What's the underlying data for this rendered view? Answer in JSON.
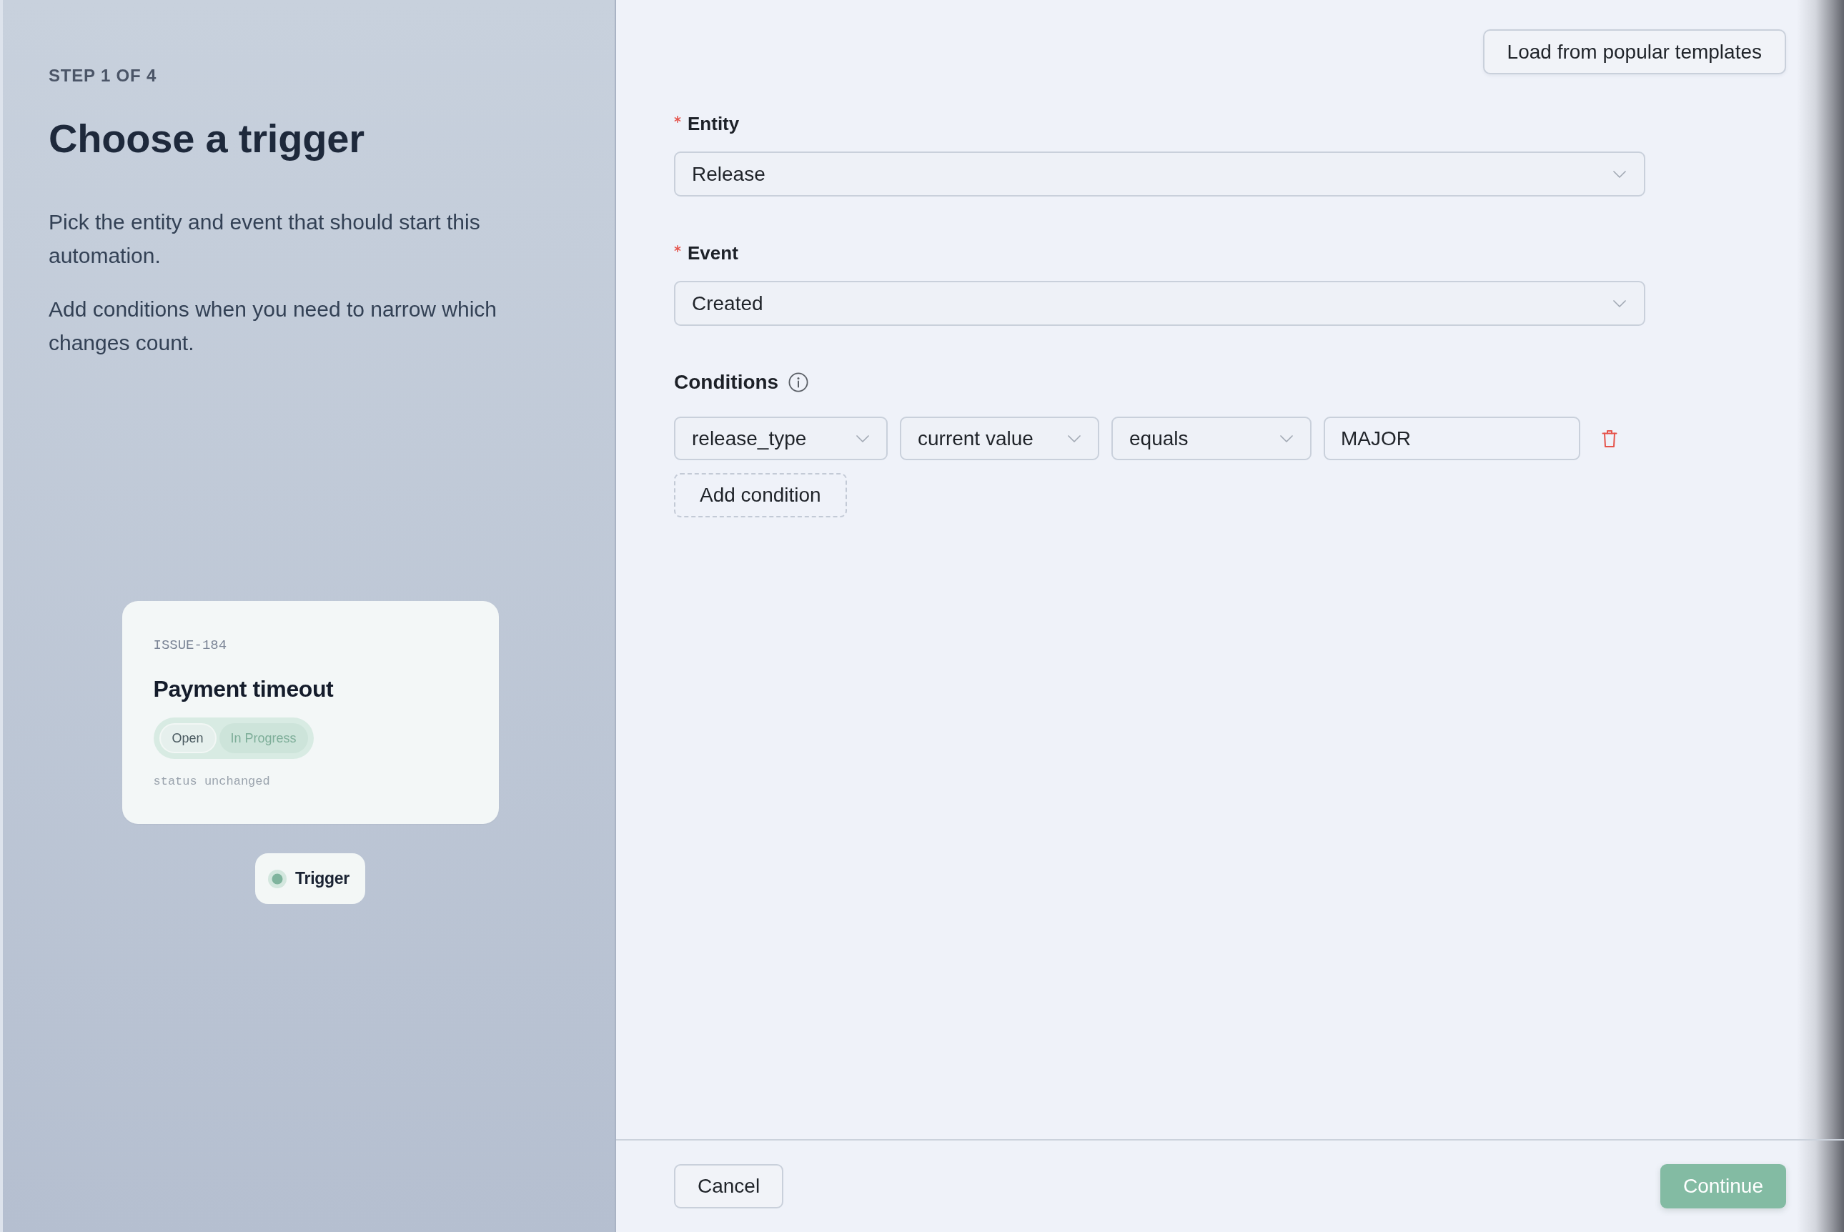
{
  "intro": {
    "step_label": "STEP 1 OF 4",
    "title": "Choose a trigger",
    "paragraphs": [
      "Pick the entity and event that should start this automation.",
      "Add conditions when you need to narrow which changes count."
    ]
  },
  "preview": {
    "issue_key": "ISSUE-184",
    "title": "Payment timeout",
    "status_chips": [
      {
        "kind": "current",
        "label": "Open"
      },
      {
        "kind": "next",
        "label": "In Progress"
      }
    ],
    "note": "status unchanged",
    "trigger_label": "Trigger"
  },
  "form": {
    "template_button": "Load from popular templates",
    "fields": [
      {
        "label": "Entity",
        "required": true,
        "value": "Release"
      },
      {
        "label": "Event",
        "required": true,
        "value": "Created"
      }
    ],
    "conditions": {
      "label": "Conditions",
      "rows": [
        {
          "cells": [
            {
              "kind": "select",
              "value": "release_type"
            },
            {
              "kind": "select",
              "value": "current value"
            },
            {
              "kind": "select",
              "value": "equals"
            },
            {
              "kind": "input",
              "value": "MAJOR"
            }
          ]
        }
      ],
      "add_button": "Add condition"
    }
  },
  "footer": {
    "cancel_button": "Cancel",
    "continue_button": "Continue"
  }
}
